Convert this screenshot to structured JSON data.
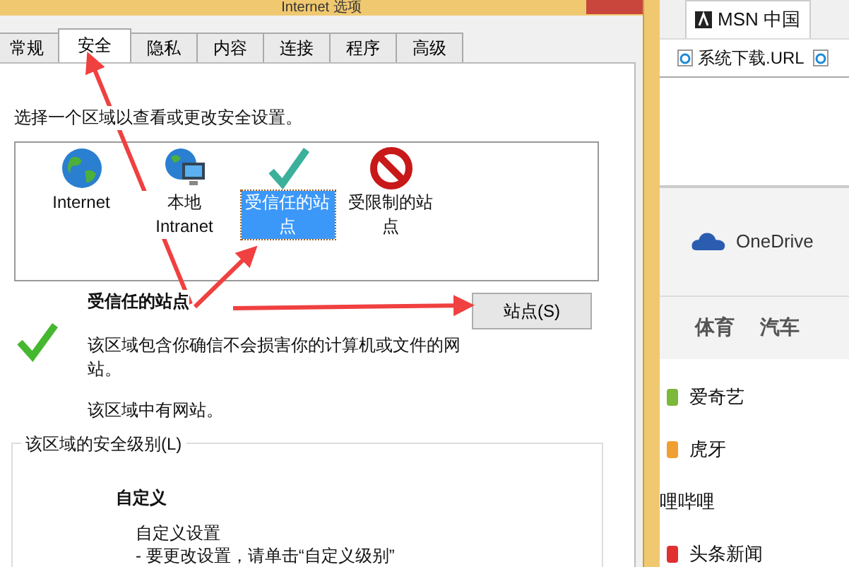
{
  "window": {
    "title": "Internet 选项"
  },
  "tabs": [
    {
      "label": "常规",
      "selected": false
    },
    {
      "label": "安全",
      "selected": true
    },
    {
      "label": "隐私",
      "selected": false
    },
    {
      "label": "内容",
      "selected": false
    },
    {
      "label": "连接",
      "selected": false
    },
    {
      "label": "程序",
      "selected": false
    },
    {
      "label": "高级",
      "selected": false
    }
  ],
  "prompt": "选择一个区域以查看或更改安全设置。",
  "zones": [
    {
      "kind": "globe",
      "label": "Internet",
      "selected": false
    },
    {
      "kind": "intranet",
      "label": "本地 Intranet",
      "selected": false
    },
    {
      "kind": "trusted",
      "label": "受信任的站点",
      "selected": true
    },
    {
      "kind": "restricted",
      "label": "受限制的站点",
      "selected": false
    }
  ],
  "zone_info": {
    "title": "受信任的站点",
    "sites_button": "站点(S)",
    "description": "该区域包含你确信不会损害你的计算机或文件的网站。",
    "note": "该区域中有网站。"
  },
  "security_level": {
    "legend": "该区域的安全级别(L)",
    "level": "自定义",
    "lines": [
      "自定义设置",
      "- 要更改设置，请单击“自定义级别”"
    ]
  },
  "browser": {
    "tab": "MSN 中国",
    "favorites": [
      "系统下载.URL"
    ],
    "onedrive": "OneDrive",
    "nav": [
      "体育",
      "汽车"
    ],
    "links": [
      {
        "kind": "iqiyi",
        "label": "爱奇艺"
      },
      {
        "kind": "huya",
        "label": "虎牙"
      },
      {
        "kind": "none",
        "label": "哩哔哩"
      },
      {
        "kind": "news",
        "label": "头条新闻"
      }
    ]
  }
}
